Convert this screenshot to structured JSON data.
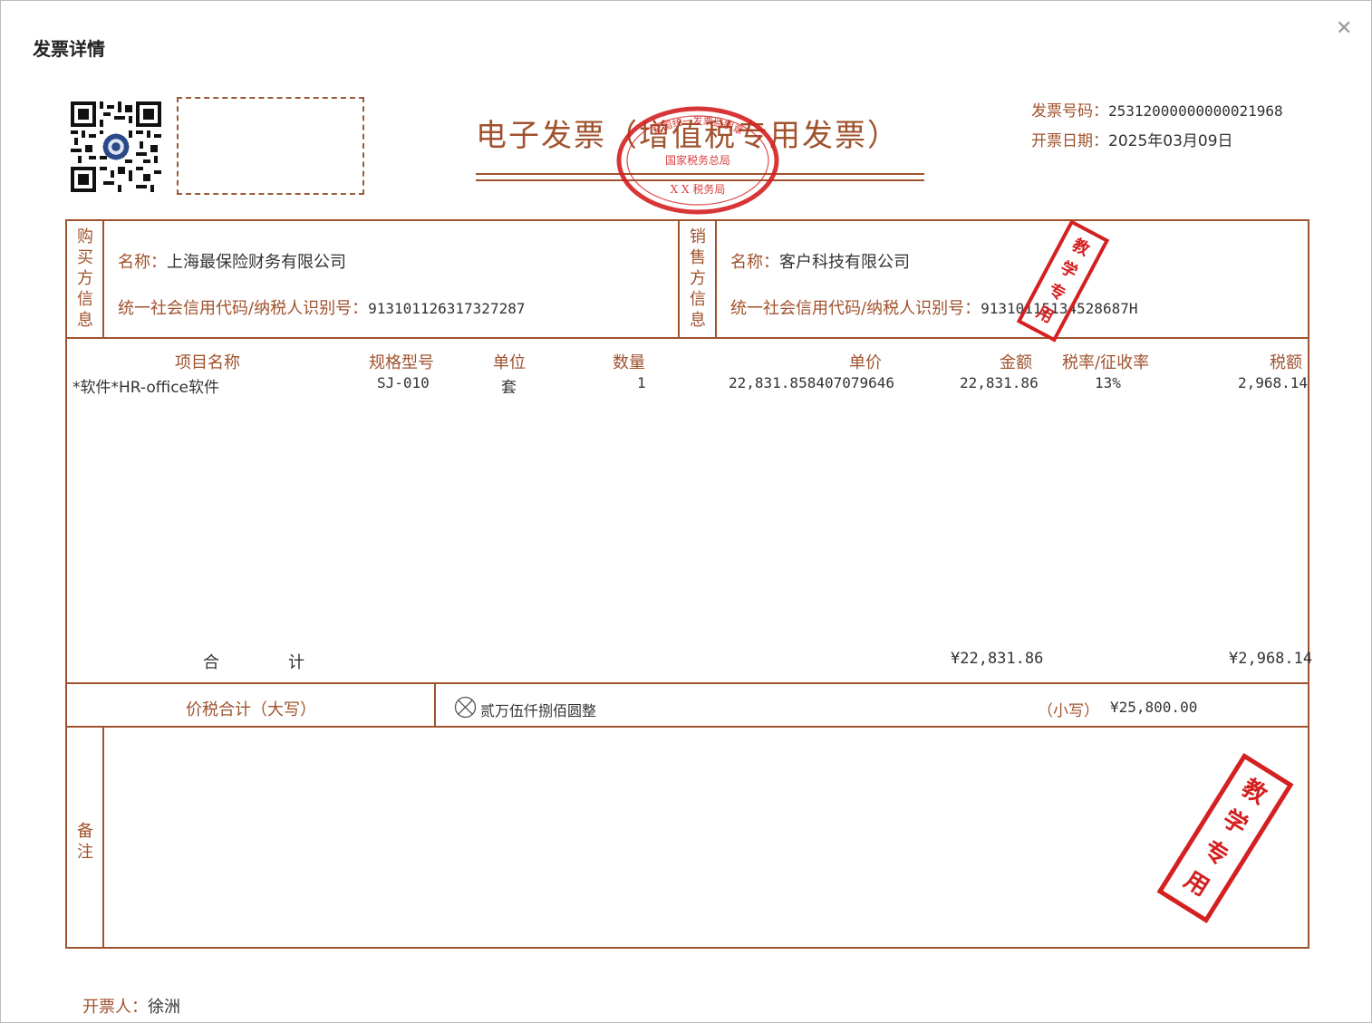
{
  "dialog": {
    "title": "发票详情"
  },
  "invoice": {
    "title": "电子发票（增值税专用发票）",
    "number_label": "发票号码：",
    "number_value": "25312000000000021968",
    "date_label": "开票日期：",
    "date_value": "2025年03月09日"
  },
  "buyer": {
    "side_label": "购买方信息",
    "name_label": "名称：",
    "name_value": "上海最保险财务有限公司",
    "tax_label": "统一社会信用代码/纳税人识别号：",
    "tax_value": "913101126317327287"
  },
  "seller": {
    "side_label": "销售方信息",
    "name_label": "名称：",
    "name_value": "客户科技有限公司",
    "tax_label": "统一社会信用代码/纳税人识别号：",
    "tax_value": "91310115134528687H"
  },
  "items": {
    "headers": {
      "name": "项目名称",
      "spec": "规格型号",
      "unit": "单位",
      "qty": "数量",
      "price": "单价",
      "amount": "金额",
      "rate": "税率/征收率",
      "tax": "税额"
    },
    "rows": [
      {
        "name": "*软件*HR-office软件",
        "spec": "SJ-010",
        "unit": "套",
        "qty": "1",
        "price": "22,831.858407079646",
        "amount": "22,831.86",
        "rate": "13%",
        "tax": "2,968.14"
      }
    ],
    "total_label_1": "合",
    "total_label_2": "计",
    "total_amount": "¥22,831.86",
    "total_tax": "¥2,968.14"
  },
  "sum": {
    "label": "价税合计（大写）",
    "capital_value": "贰万伍仟捌佰圆整",
    "small_label": "（小写）",
    "small_value": "¥25,800.00"
  },
  "remark": {
    "label": "备注"
  },
  "issuer": {
    "label": "开票人：",
    "name": "徐洲"
  },
  "seal": {
    "line1": "全国统一发票监制章",
    "line2": "国家税务总局",
    "line3": "X X 税务局"
  },
  "stamp": {
    "text": [
      "教",
      "学",
      "专",
      "用"
    ]
  },
  "colors": {
    "accent": "#a0522d",
    "seal": "#d42020"
  },
  "icons": {
    "close": "close-icon",
    "cancel_mark": "circle-x-icon"
  }
}
